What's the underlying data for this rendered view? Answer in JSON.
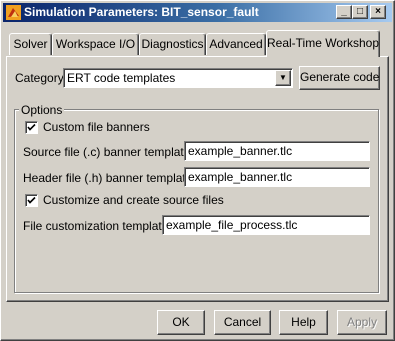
{
  "window": {
    "title": "Simulation Parameters: BIT_sensor_fault",
    "controls": {
      "minimize": "_",
      "maximize": "□",
      "close": "×"
    }
  },
  "tabs": [
    {
      "label": "Solver",
      "active": false
    },
    {
      "label": "Workspace I/O",
      "active": false
    },
    {
      "label": "Diagnostics",
      "active": false
    },
    {
      "label": "Advanced",
      "active": false
    },
    {
      "label": "Real-Time Workshop",
      "active": true
    }
  ],
  "category": {
    "label": "Category:",
    "value": "ERT code templates",
    "arrow_icon": "chevron-down-icon",
    "generate_button": "Generate code"
  },
  "options": {
    "legend": "Options",
    "custom_banners": {
      "label": "Custom file banners",
      "checked": true
    },
    "source_banner": {
      "label": "Source file (.c) banner template:",
      "value": "example_banner.tlc"
    },
    "header_banner": {
      "label": "Header file (.h) banner template:",
      "value": "example_banner.tlc"
    },
    "customize_files": {
      "label": "Customize and create source files",
      "checked": true
    },
    "file_customization": {
      "label": "File customization template:",
      "value": "example_file_process.tlc"
    }
  },
  "footer": {
    "ok": "OK",
    "cancel": "Cancel",
    "help": "Help",
    "apply": "Apply",
    "apply_enabled": false
  }
}
